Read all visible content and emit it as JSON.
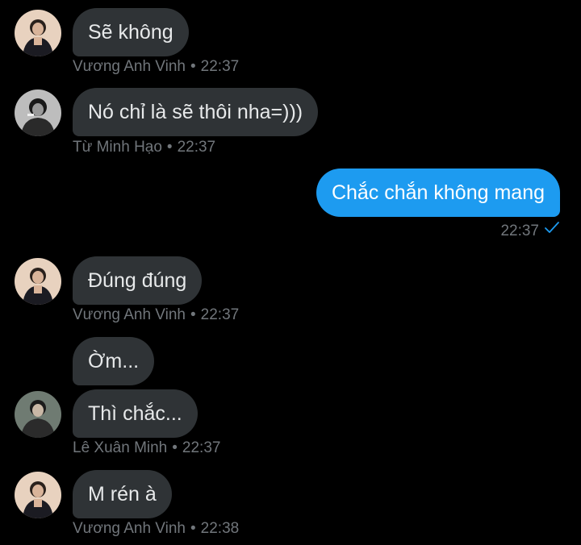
{
  "colors": {
    "background": "#000000",
    "incoming_bubble": "#2f3336",
    "outgoing_bubble": "#1d9bf0",
    "meta_text": "#71767b",
    "check": "#1d9bf0"
  },
  "messages": [
    {
      "sender": "Vương Anh Vinh",
      "text": "Sẽ không",
      "time": "22:37",
      "direction": "incoming",
      "avatar": "avatar-vinh"
    },
    {
      "sender": "Từ Minh Hạo",
      "text": "Nó chỉ là sẽ thôi nha=)))",
      "time": "22:37",
      "direction": "incoming",
      "avatar": "avatar-hao"
    },
    {
      "text": "Chắc chắn không mang",
      "time": "22:37",
      "direction": "outgoing",
      "status_icon": "check-icon"
    },
    {
      "sender": "Vương Anh Vinh",
      "text": "Đúng đúng",
      "time": "22:37",
      "direction": "incoming",
      "avatar": "avatar-vinh"
    },
    {
      "text": "Ờm...",
      "direction": "incoming"
    },
    {
      "sender": "Lê Xuân Minh",
      "text": "Thì chắc...",
      "time": "22:37",
      "direction": "incoming",
      "avatar": "avatar-minh"
    },
    {
      "sender": "Vương Anh Vinh",
      "text": "M rén à",
      "time": "22:38",
      "direction": "incoming",
      "avatar": "avatar-vinh"
    }
  ],
  "separator": "•"
}
